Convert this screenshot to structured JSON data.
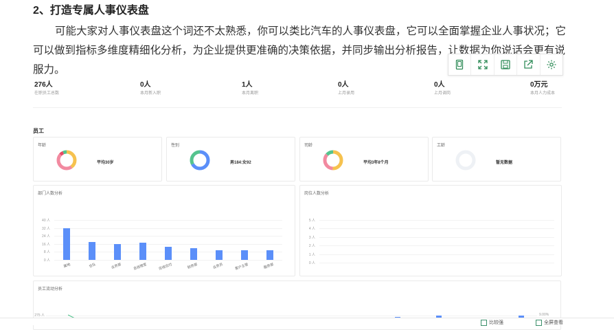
{
  "article": {
    "heading": "2、打造专属人事仪表盘",
    "paragraph": "可能大家对人事仪表盘这个词还不太熟悉，你可以类比汽车的人事仪表盘，它可以全面掌握企业人事状况；它可以做到指标多维度精细化分析，为企业提供更准确的决策依据，并同步输出分析报告，让数据为你说话会更有说服力。"
  },
  "toolbar": {
    "icons": [
      "tablet-icon",
      "fullscreen-icon",
      "save-icon",
      "share-icon",
      "settings-icon"
    ],
    "accent": "#2e8b57"
  },
  "stats": [
    {
      "value": "276人",
      "label": "在职员工总数"
    },
    {
      "value": "0人",
      "label": "本月新入职"
    },
    {
      "value": "1人",
      "label": "本月离职"
    },
    {
      "value": "0人",
      "label": "上月录用"
    },
    {
      "value": "0人",
      "label": "上月调岗"
    },
    {
      "value": "0万元",
      "label": "本月人力成本"
    }
  ],
  "section": {
    "title": "员工"
  },
  "cards": [
    {
      "title": "年龄",
      "text": "平均30岁"
    },
    {
      "title": "性别",
      "text": "男184:女92"
    },
    {
      "title": "司龄",
      "text": "平均3年8个月"
    },
    {
      "title": "工龄",
      "text": "暂无数据"
    }
  ],
  "dept_chart": {
    "title": "部门人数分析",
    "chart_data": {
      "type": "bar",
      "categories": [
        "属地",
        "仓队",
        "业务部",
        "总经理室",
        "应收应付",
        "财务部",
        "业务员",
        "客户主管",
        "服务部"
      ],
      "values": [
        32,
        18,
        16,
        17,
        13,
        12,
        10,
        10,
        10
      ],
      "yticks": [
        "0 人",
        "8 人",
        "16 人",
        "24 人",
        "32 人",
        "40 人"
      ],
      "ylim": [
        0,
        40
      ]
    }
  },
  "post_chart": {
    "title": "岗位人数分析",
    "yticks": [
      "0 人",
      "1 人",
      "2 人",
      "3 人",
      "4 人",
      "5 人"
    ]
  },
  "flow_chart": {
    "title": "员工流动分析",
    "ytick": "275 人",
    "rtick": "9.00%"
  },
  "status_bar": {
    "items": [
      "比较强",
      "全屏查看"
    ]
  }
}
